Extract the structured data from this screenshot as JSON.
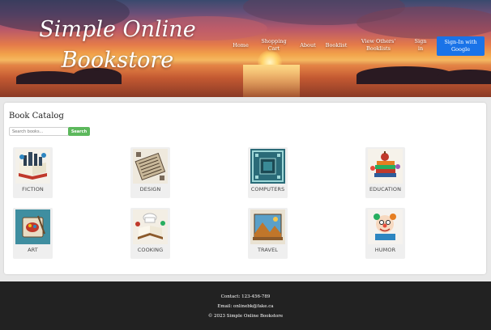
{
  "header": {
    "brand_line1": "Simple Online",
    "brand_line2": "Bookstore",
    "nav": [
      {
        "label": "Home"
      },
      {
        "label": "Shopping Cart"
      },
      {
        "label": "About"
      },
      {
        "label": "Booklist"
      },
      {
        "label": "View Others' Booklists"
      },
      {
        "label": "Sign in"
      }
    ],
    "google_signin_label": "Sign-In with Google",
    "google_button_color": "#1a73e8"
  },
  "catalog": {
    "title": "Book Catalog",
    "search_placeholder": "Search books...",
    "search_button_label": "Search",
    "search_button_color": "#5cb85c",
    "categories": [
      {
        "label": "FICTION",
        "icon": "fiction-book-icon"
      },
      {
        "label": "DESIGN",
        "icon": "design-book-icon"
      },
      {
        "label": "COMPUTERS",
        "icon": "computers-book-icon"
      },
      {
        "label": "EDUCATION",
        "icon": "education-book-icon"
      },
      {
        "label": "ART",
        "icon": "art-book-icon"
      },
      {
        "label": "COOKING",
        "icon": "cooking-book-icon"
      },
      {
        "label": "TRAVEL",
        "icon": "travel-book-icon"
      },
      {
        "label": "HUMOR",
        "icon": "humor-book-icon"
      }
    ]
  },
  "footer": {
    "contact": "Contact: 123-456-789",
    "email": "Email: onlinebk@fake.ca",
    "copyright": "© 2023 Simple Online Bookstore"
  }
}
